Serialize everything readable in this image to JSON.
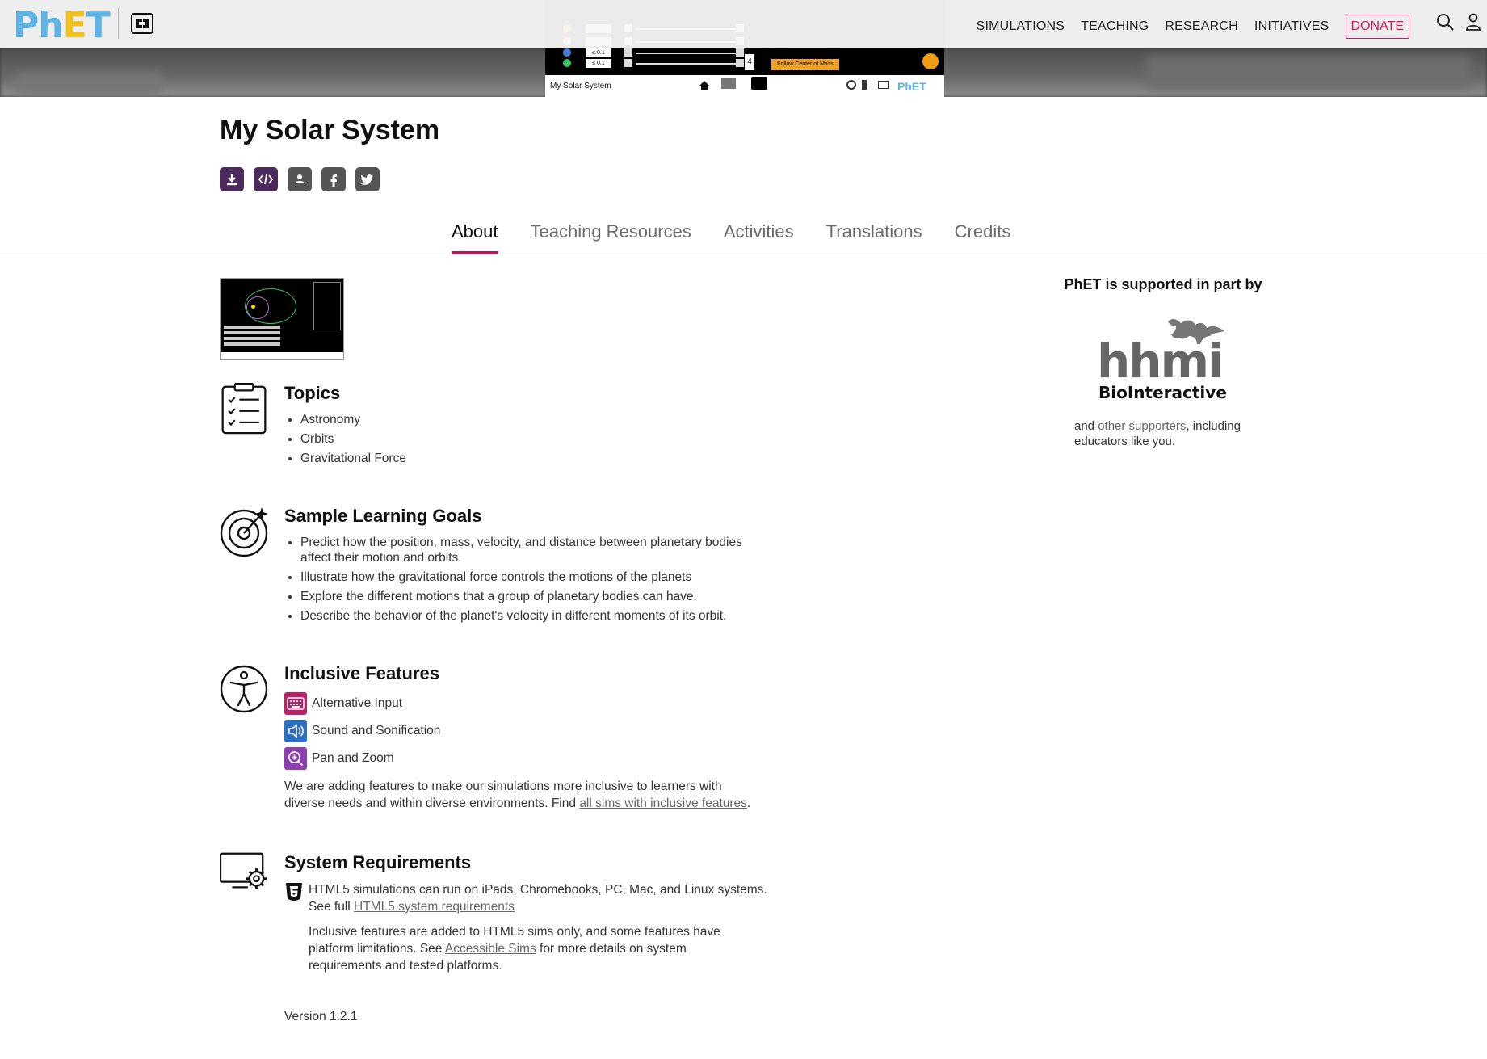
{
  "nav": {
    "logo_ph": "Ph",
    "logo_e": "E",
    "logo_t": "T",
    "links": [
      "SIMULATIONS",
      "TEACHING",
      "RESEARCH",
      "INITIATIVES"
    ],
    "donate": "DONATE"
  },
  "sim_preview": {
    "title": "My Solar System",
    "follow_label": "Follow Center of Mass",
    "bodies_count": "4",
    "value_a": "≤ 0.1",
    "value_b": "≤ 0.1",
    "logo": "PhET"
  },
  "page": {
    "title": "My Solar System"
  },
  "tabs": [
    "About",
    "Teaching Resources",
    "Activities",
    "Translations",
    "Credits"
  ],
  "topics": {
    "heading": "Topics",
    "items": [
      "Astronomy",
      "Orbits",
      "Gravitational Force"
    ]
  },
  "learning_goals": {
    "heading": "Sample Learning Goals",
    "items": [
      "Predict how the position, mass, velocity, and distance between planetary bodies affect their motion and orbits.",
      "Illustrate how the gravitational force controls the motions of the planets",
      "Explore the different motions that a group of planetary bodies can have.",
      "Describe the behavior of the planet's velocity in different moments of its orbit."
    ]
  },
  "inclusive": {
    "heading": "Inclusive Features",
    "features": [
      {
        "label": "Alternative Input",
        "icon": "keyboard-icon",
        "color": "#b8236a"
      },
      {
        "label": "Sound and Sonification",
        "icon": "speaker-icon",
        "color": "#2d6fc0"
      },
      {
        "label": "Pan and Zoom",
        "icon": "zoom-icon",
        "color": "#8b3fb0"
      }
    ],
    "para_pre": "We are adding features to make our simulations more inclusive to learners with diverse needs and within diverse environments. Find ",
    "para_link": "all sims with inclusive features",
    "para_post": "."
  },
  "requirements": {
    "heading": "System Requirements",
    "line1": "HTML5 simulations can run on iPads, Chromebooks, PC, Mac, and Linux systems.",
    "line2_pre": "See full ",
    "line2_link": "HTML5 system requirements",
    "para_pre": "Inclusive features are added to HTML5 sims only, and some features have platform limitations. See ",
    "para_link": "Accessible Sims",
    "para_post": " for more details on system requirements and tested platforms."
  },
  "version": "Version 1.2.1",
  "support": {
    "title": "PhET is supported in part by",
    "logo_word": "hhmi",
    "logo_sub": "BioInteractive",
    "text_pre": "and ",
    "text_link": "other supporters",
    "text_post": ", including educators like you."
  },
  "colors": {
    "accent": "#c0155c",
    "donate": "#d4145a",
    "share_purple": "#4b2a5c",
    "share_grey": "#555555"
  }
}
